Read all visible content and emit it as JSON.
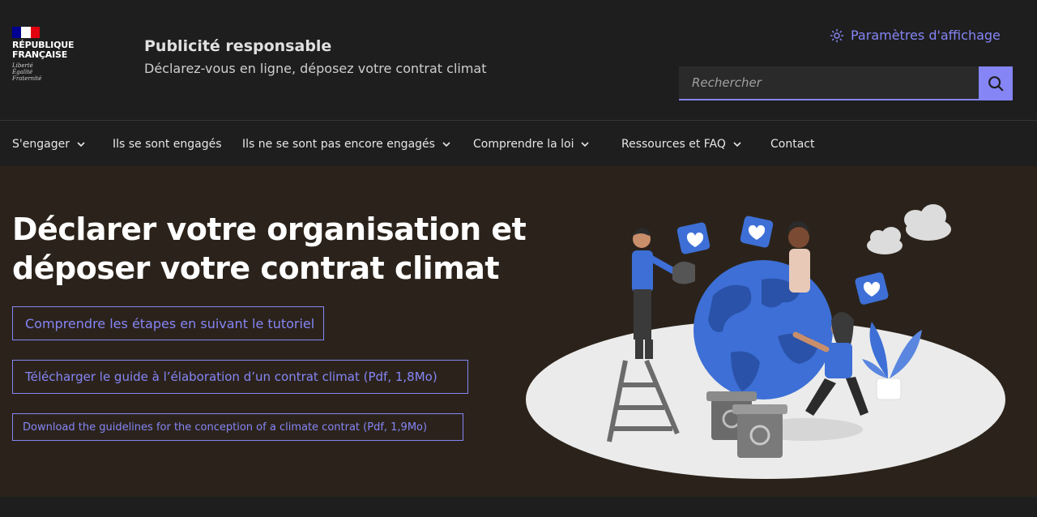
{
  "header": {
    "logo": {
      "line1": "RÉPUBLIQUE",
      "line2": "FRANÇAISE",
      "motto": [
        "Liberté",
        "Égalité",
        "Fraternité"
      ]
    },
    "service_title": "Publicité responsable",
    "service_tagline": "Déclarez-vous en ligne, déposez votre contrat climat",
    "display_settings_label": "Paramètres d'affichage",
    "search": {
      "placeholder": "Rechercher"
    }
  },
  "nav": {
    "items": [
      {
        "label": "S'engager",
        "has_dropdown": true
      },
      {
        "label": "Ils se sont engagés",
        "has_dropdown": false
      },
      {
        "label": "Ils ne se sont pas encore engagés",
        "has_dropdown": true
      },
      {
        "label": "Comprendre la loi",
        "has_dropdown": true
      },
      {
        "label": "Ressources et FAQ",
        "has_dropdown": true
      },
      {
        "label": "Contact",
        "has_dropdown": false
      }
    ]
  },
  "hero": {
    "title": "Déclarer votre organisation et déposer votre contrat climat",
    "buttons": [
      "Comprendre les étapes en suivant le tutoriel",
      "Télécharger le guide à l’élaboration d’un contrat climat (Pdf, 1,8Mo)",
      "Download the guidelines for the conception of a climate contrat (Pdf, 1,9Mo)"
    ]
  },
  "colors": {
    "accent": "#8585f6",
    "header_bg": "#1e1e1e",
    "hero_bg": "#2b231b",
    "illustration_blue": "#3d6fd6",
    "flag_blue": "#000091",
    "flag_red": "#e1000f"
  },
  "icons": {
    "display_settings": "sun-icon",
    "search": "search-icon",
    "dropdown": "chevron-down-icon"
  }
}
